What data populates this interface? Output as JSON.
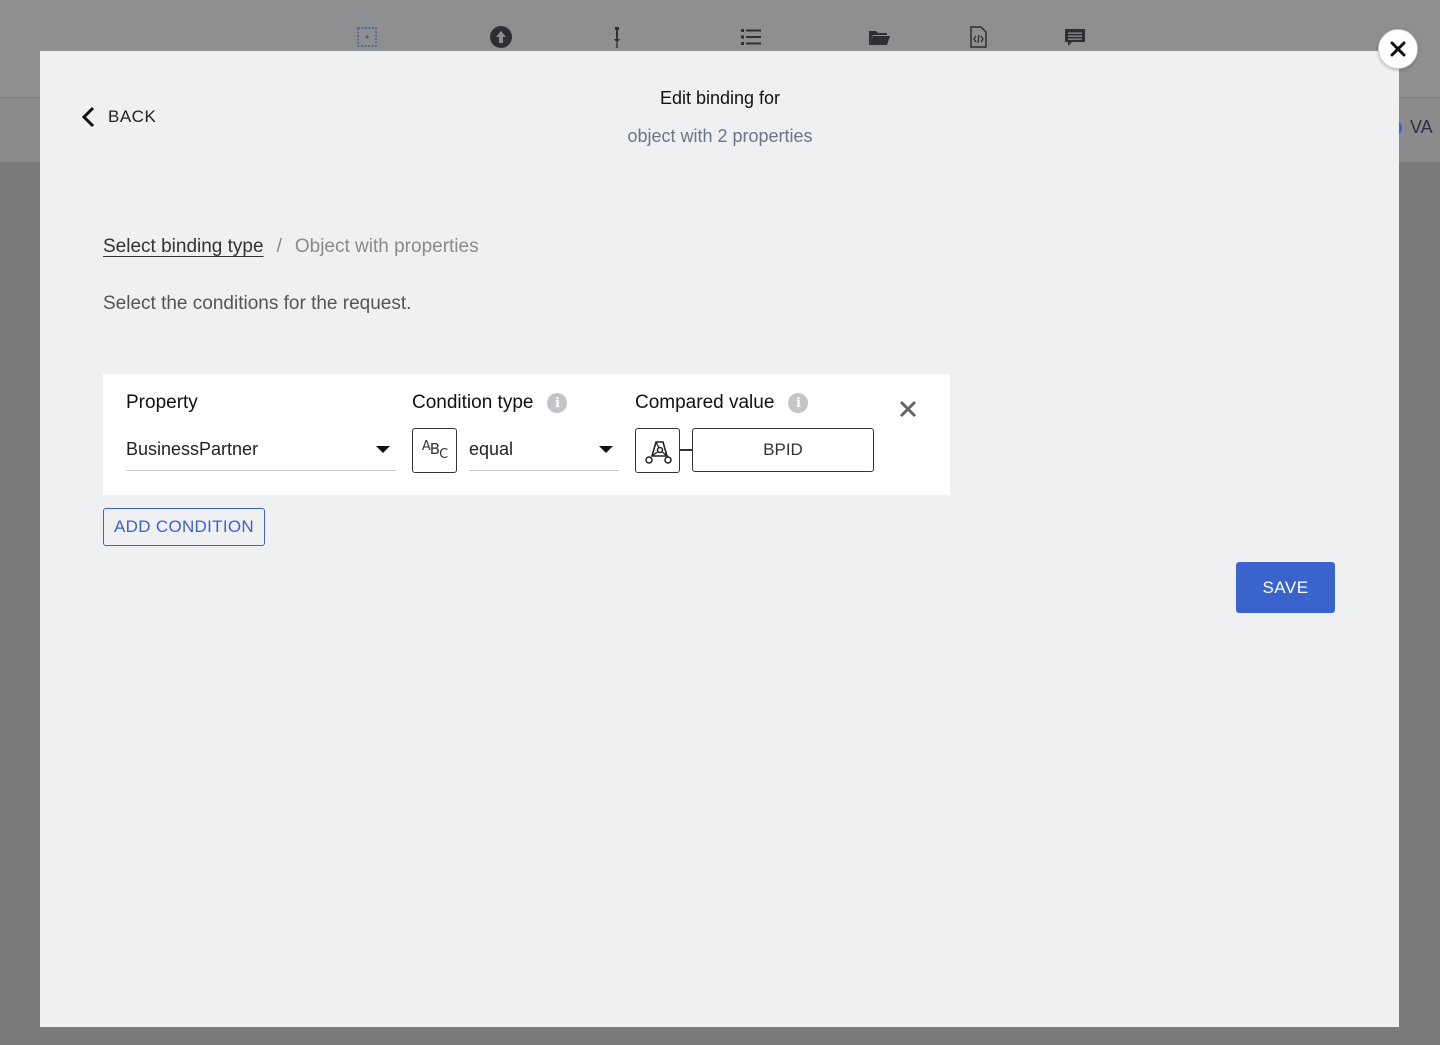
{
  "background": {
    "toolbar_icons": [
      {
        "name": "grid-select-icon"
      },
      {
        "name": "upload-icon"
      },
      {
        "name": "pin-icon"
      },
      {
        "name": "list-icon"
      },
      {
        "name": "folder-icon"
      },
      {
        "name": "code-file-icon"
      },
      {
        "name": "comment-icon"
      }
    ],
    "right_label": "VA"
  },
  "modal": {
    "back_label": "BACK",
    "title": "Edit binding for",
    "subtitle": "object with 2 properties",
    "breadcrumb": {
      "link": "Select binding type",
      "separator": "/",
      "current": "Object with properties"
    },
    "instructions": "Select the conditions for the request.",
    "condition": {
      "property_label": "Property",
      "property_value": "BusinessPartner",
      "condition_type_label": "Condition type",
      "condition_type_icon": "abc-text-type-icon",
      "condition_value": "equal",
      "compared_value_label": "Compared value",
      "compared_value_icon": "data-model-icon",
      "compared_value": "BPID"
    },
    "add_condition_label": "ADD CONDITION",
    "save_label": "SAVE"
  },
  "colors": {
    "accent": "#3b63cd",
    "modal_bg": "#eff0f2",
    "overlay": "#7a7b7d"
  }
}
